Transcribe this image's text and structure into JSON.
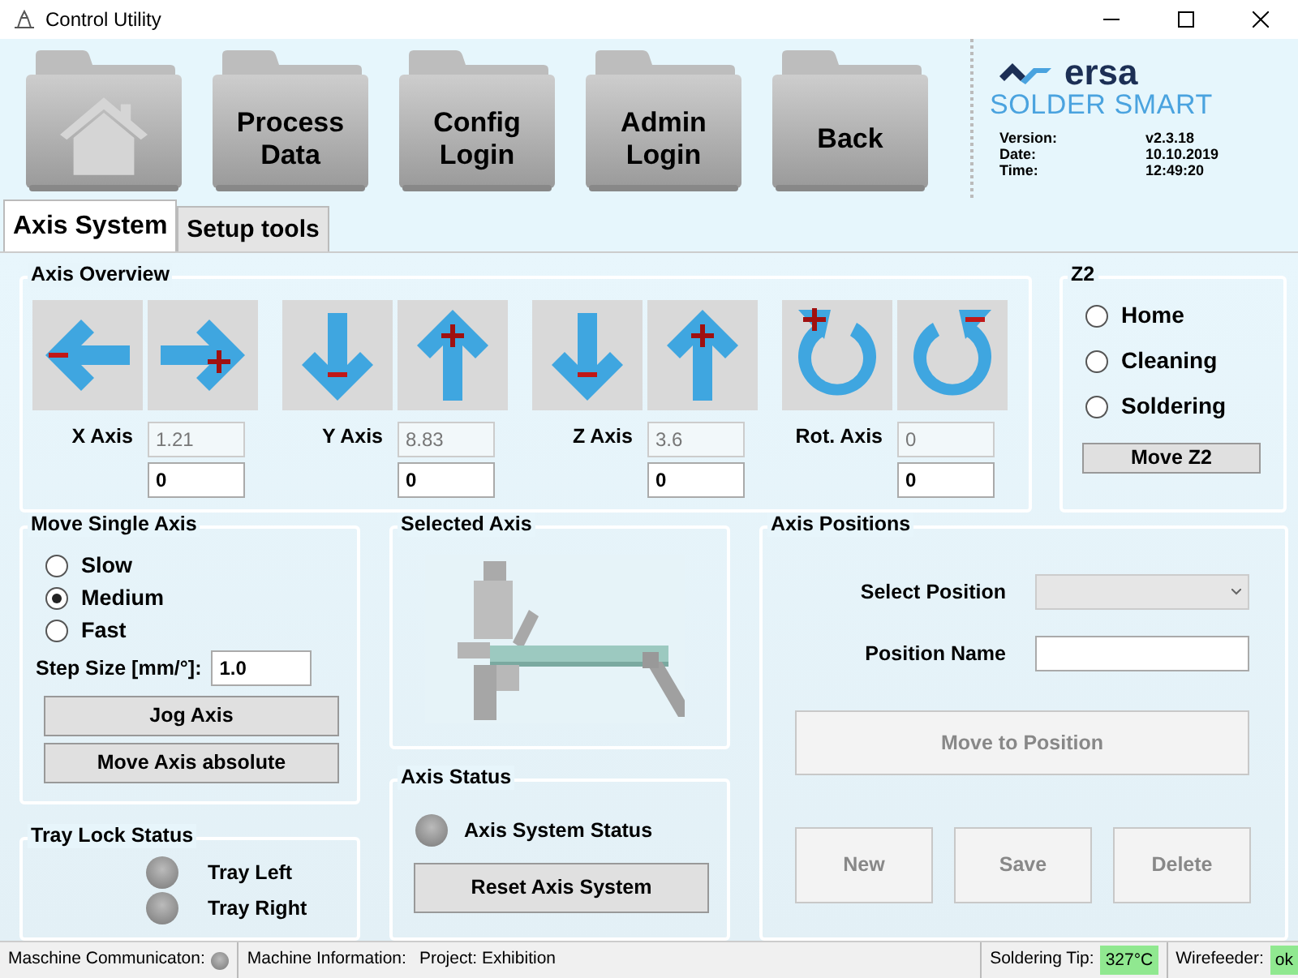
{
  "window": {
    "title": "Control Utility"
  },
  "nav_buttons": [
    {
      "kind": "home"
    },
    {
      "kind": "text",
      "label": "Process Data"
    },
    {
      "kind": "text",
      "label": "Config Login"
    },
    {
      "kind": "text",
      "label": "Admin Login"
    },
    {
      "kind": "text",
      "label": "Back"
    }
  ],
  "logo": {
    "brand": "ersa",
    "product": "SOLDER SMART"
  },
  "info": [
    {
      "label": "Version:",
      "value": "v2.3.18"
    },
    {
      "label": "Date:",
      "value": "10.10.2019"
    },
    {
      "label": "Time:",
      "value": "12:49:20"
    }
  ],
  "tabs": [
    {
      "label": "Axis System",
      "selected": true
    },
    {
      "label": "Setup tools",
      "selected": false
    }
  ],
  "axis_overview": {
    "title": "Axis Overview",
    "axes": [
      {
        "label": "X Axis",
        "current": "1.21",
        "target": "0",
        "buttons": [
          {
            "kind": "left"
          },
          {
            "kind": "right"
          }
        ]
      },
      {
        "label": "Y Axis",
        "current": "8.83",
        "target": "0",
        "buttons": [
          {
            "kind": "down"
          },
          {
            "kind": "up"
          }
        ]
      },
      {
        "label": "Z Axis",
        "current": "3.6",
        "target": "0",
        "buttons": [
          {
            "kind": "down"
          },
          {
            "kind": "up"
          }
        ]
      },
      {
        "label": "Rot. Axis",
        "current": "0",
        "target": "0",
        "buttons": [
          {
            "kind": "cw"
          },
          {
            "kind": "ccw"
          }
        ]
      }
    ]
  },
  "z2": {
    "title": "Z2",
    "options": [
      {
        "label": "Home",
        "selected": false
      },
      {
        "label": "Cleaning",
        "selected": false
      },
      {
        "label": "Soldering",
        "selected": false
      }
    ],
    "button": "Move Z2"
  },
  "move_single_axis": {
    "title": "Move Single Axis",
    "speeds": [
      {
        "label": "Slow",
        "selected": false
      },
      {
        "label": "Medium",
        "selected": true
      },
      {
        "label": "Fast",
        "selected": false
      }
    ],
    "step_label": "Step Size [mm/°]:",
    "step_value": "1.0",
    "buttons": [
      "Jog Axis",
      "Move Axis absolute"
    ]
  },
  "tray_lock_status": {
    "title": "Tray Lock Status",
    "lamps": [
      {
        "label": "Tray Left",
        "on": false
      },
      {
        "label": "Tray Right",
        "on": false
      }
    ]
  },
  "selected_axis": {
    "title": "Selected Axis"
  },
  "axis_status": {
    "title": "Axis Status",
    "lamp": {
      "label": "Axis System Status",
      "on": false
    },
    "button": "Reset Axis System"
  },
  "axis_positions": {
    "title": "Axis Positions",
    "select_label": "Select Position",
    "name_label": "Position Name",
    "move_button": {
      "label": "Move to Position",
      "disabled": true
    },
    "buttons": [
      {
        "label": "New",
        "disabled": true
      },
      {
        "label": "Save",
        "disabled": true
      },
      {
        "label": "Delete",
        "disabled": true
      }
    ]
  },
  "status_bar": {
    "communication": {
      "label": "Maschine Communicaton:",
      "on": false
    },
    "info_label": "Machine Information:",
    "project": "Project: Exhibition",
    "tip_label": "Soldering Tip:",
    "tip_value": "327°C",
    "wirefeeder_label": "Wirefeeder:",
    "wirefeeder_value": "ok"
  }
}
